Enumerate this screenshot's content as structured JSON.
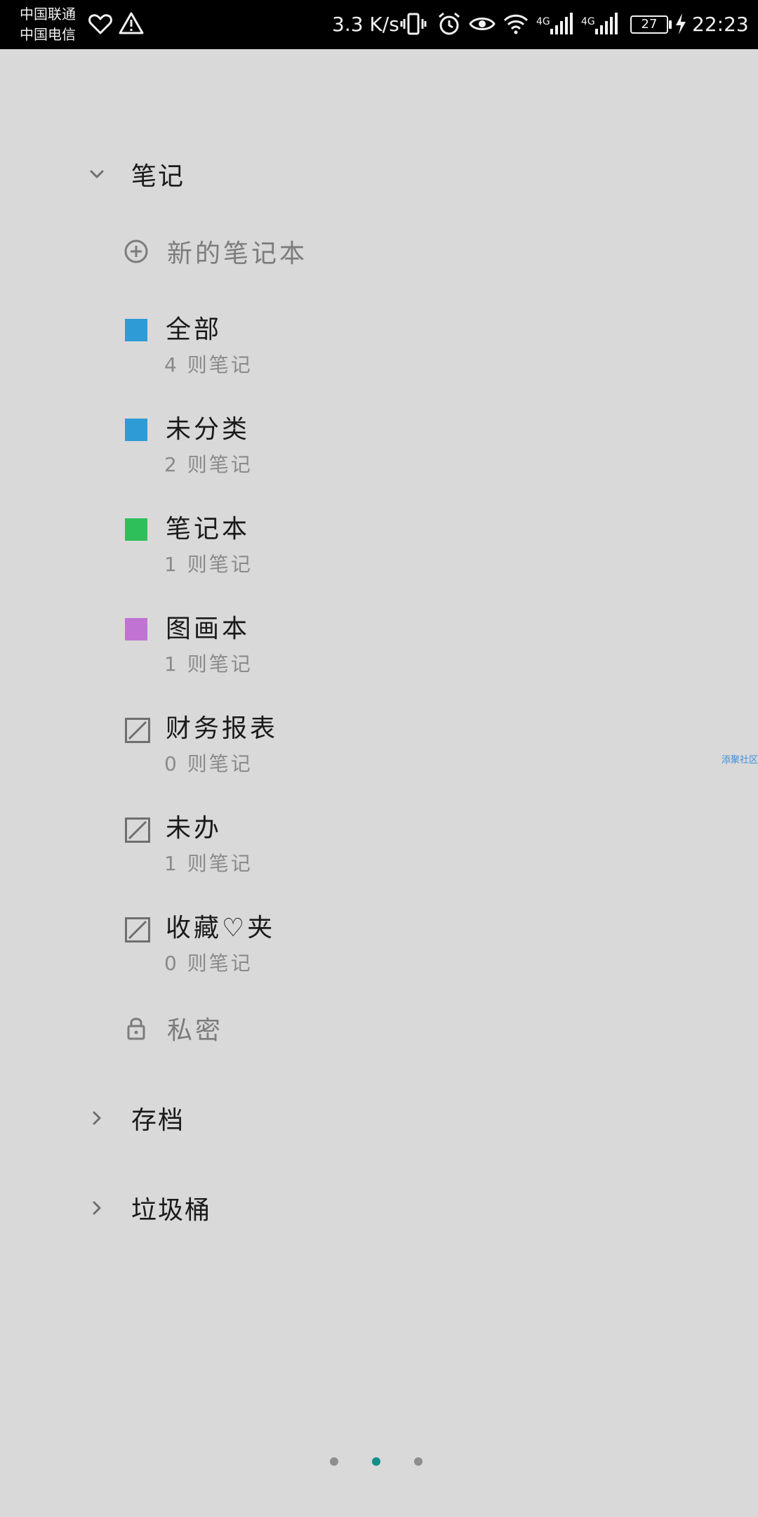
{
  "status_bar": {
    "carrier_1": "中国联通",
    "carrier_2": "中国电信",
    "net_speed": "3.3 K/s",
    "battery": "27",
    "time": "22:23",
    "signal_1_label": "4G",
    "signal_2_label": "4G"
  },
  "sections": {
    "notes_label": "笔记",
    "archive_label": "存档",
    "trash_label": "垃圾桶"
  },
  "new_notebook_label": "新的笔记本",
  "notebooks": [
    {
      "title": "全部",
      "count": "4 则笔记",
      "color": "#2e9bd6",
      "type": "filled"
    },
    {
      "title": "未分类",
      "count": "2 则笔记",
      "color": "#2e9bd6",
      "type": "filled"
    },
    {
      "title": "笔记本",
      "count": "1 则笔记",
      "color": "#2fbf5a",
      "type": "filled"
    },
    {
      "title": "图画本",
      "count": "1 则笔记",
      "color": "#c073d3",
      "type": "filled"
    },
    {
      "title": "财务报表",
      "count": "0 则笔记",
      "color": "#6f6f6f",
      "type": "empty"
    },
    {
      "title": "未办",
      "count": "1 则笔记",
      "color": "#6f6f6f",
      "type": "empty"
    },
    {
      "title": "收藏♡夹",
      "count": "0 则笔记",
      "color": "#6f6f6f",
      "type": "empty"
    }
  ],
  "private_label": "私密",
  "side_tag": "添聚社区",
  "pager": {
    "count": 3,
    "active_index": 1,
    "active_color": "#138f8a"
  }
}
